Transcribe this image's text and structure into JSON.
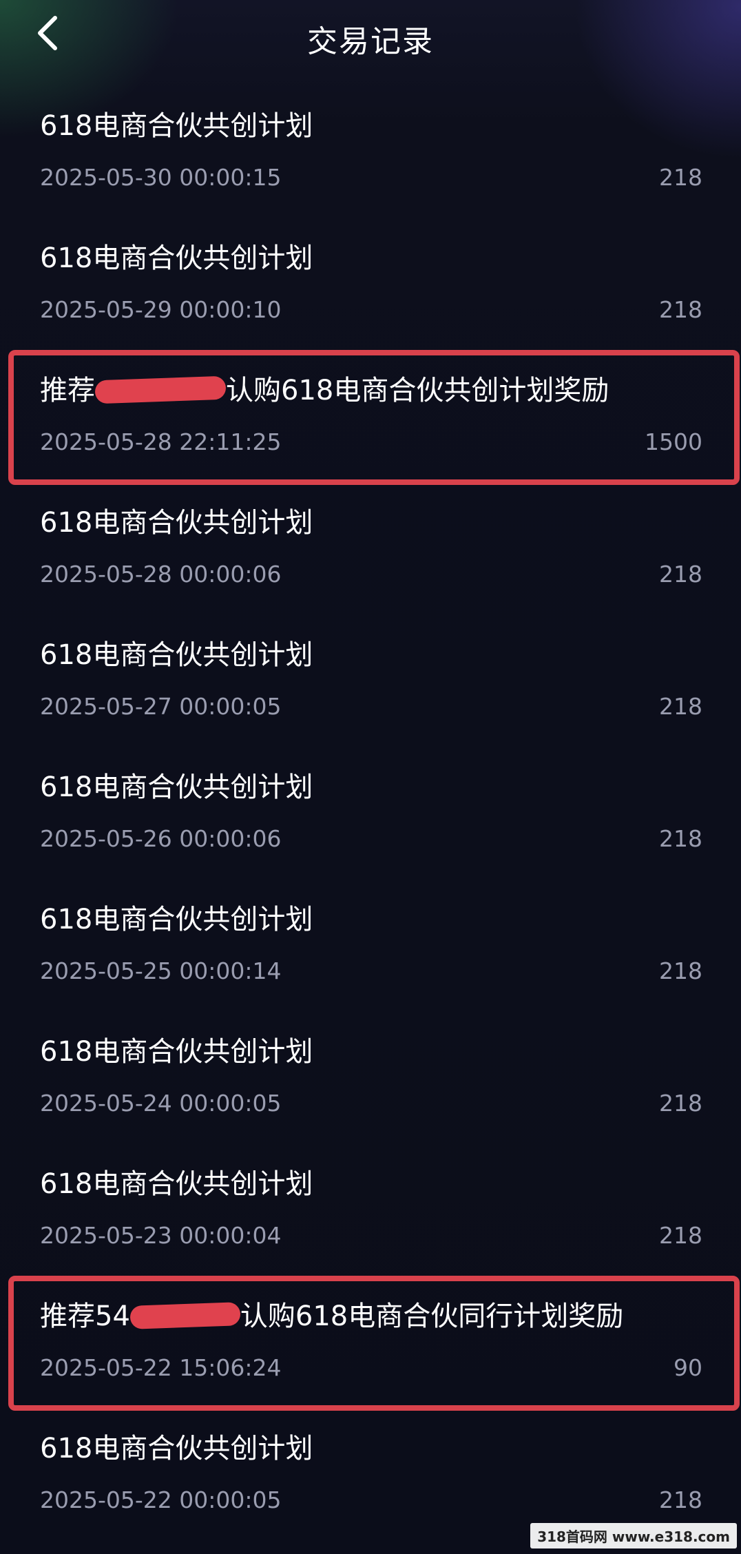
{
  "header": {
    "title": "交易记录",
    "back_icon": "chevron-left-icon"
  },
  "records": [
    {
      "title": "618电商合伙共创计划",
      "time": "2025-05-30 00:00:15",
      "amount": "218",
      "highlighted": false
    },
    {
      "title": "618电商合伙共创计划",
      "time": "2025-05-29 00:00:10",
      "amount": "218",
      "highlighted": false
    },
    {
      "title_prefix": "推荐",
      "title_suffix": "认购618电商合伙共创计划奖励",
      "time": "2025-05-28 22:11:25",
      "amount": "1500",
      "highlighted": true
    },
    {
      "title": "618电商合伙共创计划",
      "time": "2025-05-28 00:00:06",
      "amount": "218",
      "highlighted": false
    },
    {
      "title": "618电商合伙共创计划",
      "time": "2025-05-27 00:00:05",
      "amount": "218",
      "highlighted": false
    },
    {
      "title": "618电商合伙共创计划",
      "time": "2025-05-26 00:00:06",
      "amount": "218",
      "highlighted": false
    },
    {
      "title": "618电商合伙共创计划",
      "time": "2025-05-25 00:00:14",
      "amount": "218",
      "highlighted": false
    },
    {
      "title": "618电商合伙共创计划",
      "time": "2025-05-24 00:00:05",
      "amount": "218",
      "highlighted": false
    },
    {
      "title": "618电商合伙共创计划",
      "time": "2025-05-23 00:00:04",
      "amount": "218",
      "highlighted": false
    },
    {
      "title_prefix": "推荐54",
      "title_suffix": "认购618电商合伙同行计划奖励",
      "time": "2025-05-22 15:06:24",
      "amount": "90",
      "highlighted": true
    },
    {
      "title": "618电商合伙共创计划",
      "time": "2025-05-22 00:00:05",
      "amount": "218",
      "highlighted": false
    }
  ],
  "colors": {
    "background": "#0d0f1c",
    "highlight": "#d9424c",
    "redaction": "#e0424e",
    "secondary_text": "#9a9db0"
  },
  "watermark": "318首码网 www.e318.com"
}
